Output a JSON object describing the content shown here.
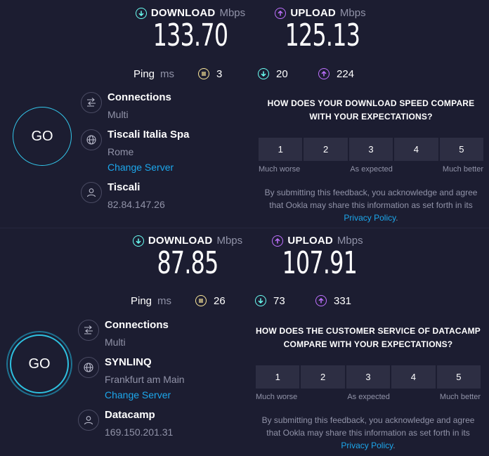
{
  "tests": [
    {
      "download": {
        "label": "DOWNLOAD",
        "unit": "Mbps",
        "value": "133.70"
      },
      "upload": {
        "label": "UPLOAD",
        "unit": "Mbps",
        "value": "125.13"
      },
      "ping": {
        "label": "Ping",
        "unit": "ms",
        "jitter": "3",
        "download": "20",
        "upload": "224"
      },
      "go_label": "GO",
      "connections": {
        "title": "Connections",
        "value": "Multi"
      },
      "server": {
        "name": "Tiscali Italia Spa",
        "location": "Rome",
        "change_label": "Change Server"
      },
      "provider": {
        "name": "Tiscali",
        "ip": "82.84.147.26"
      },
      "feedback": {
        "question": "HOW DOES YOUR DOWNLOAD SPEED COMPARE WITH YOUR EXPECTATIONS?",
        "options": [
          "1",
          "2",
          "3",
          "4",
          "5"
        ],
        "low_label": "Much worse",
        "mid_label": "As expected",
        "high_label": "Much better",
        "note": "By submitting this feedback, you acknowledge and agree that Ookla may share this information as set forth in its",
        "privacy_link": "Privacy Policy",
        "note_end": "."
      }
    },
    {
      "download": {
        "label": "DOWNLOAD",
        "unit": "Mbps",
        "value": "87.85"
      },
      "upload": {
        "label": "UPLOAD",
        "unit": "Mbps",
        "value": "107.91"
      },
      "ping": {
        "label": "Ping",
        "unit": "ms",
        "jitter": "26",
        "download": "73",
        "upload": "331"
      },
      "go_label": "GO",
      "connections": {
        "title": "Connections",
        "value": "Multi"
      },
      "server": {
        "name": "SYNLINQ",
        "location": "Frankfurt am Main",
        "change_label": "Change Server"
      },
      "provider": {
        "name": "Datacamp",
        "ip": "169.150.201.31"
      },
      "feedback": {
        "question": "HOW DOES THE CUSTOMER SERVICE OF DATACAMP COMPARE WITH YOUR EXPECTATIONS?",
        "options": [
          "1",
          "2",
          "3",
          "4",
          "5"
        ],
        "low_label": "Much worse",
        "mid_label": "As expected",
        "high_label": "Much better",
        "note": "By submitting this feedback, you acknowledge and agree that Ookla may share this information as set forth in its",
        "privacy_link": "Privacy Policy",
        "note_end": "."
      }
    }
  ],
  "colors": {
    "background": "#1c1d31",
    "download": "#6afff3",
    "upload": "#bf71ff",
    "jitter": "#fbe79a",
    "link": "#1ca7ec",
    "go_ring": "#33c5e9"
  },
  "icons": {
    "download": "arrow-down-circle-icon",
    "upload": "arrow-up-circle-icon",
    "jitter": "jitter-icon",
    "connections": "connections-icon",
    "server": "globe-icon",
    "provider": "user-icon"
  }
}
